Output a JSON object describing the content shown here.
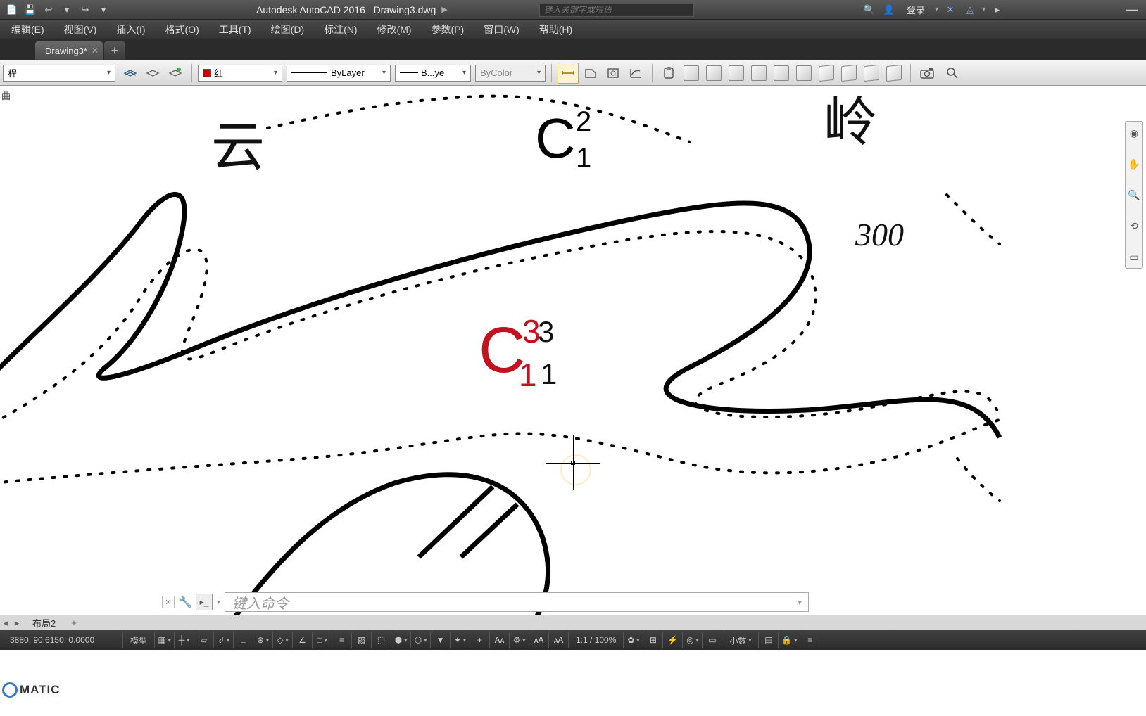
{
  "titlebar": {
    "app": "Autodesk AutoCAD 2016",
    "file": "Drawing3.dwg",
    "search_placeholder": "键入关键字或短语",
    "login": "登录"
  },
  "menu": {
    "items": [
      "编辑(E)",
      "视图(V)",
      "插入(I)",
      "格式(O)",
      "工具(T)",
      "绘图(D)",
      "标注(N)",
      "修改(M)",
      "参数(P)",
      "窗口(W)",
      "帮助(H)"
    ]
  },
  "doctabs": {
    "active": "Drawing3*"
  },
  "properties": {
    "layer": "程",
    "color": "红",
    "linetype": "ByLayer",
    "lineweight": "B...ye",
    "plotstyle": "ByColor"
  },
  "canvas": {
    "side_label": "曲",
    "text_yun": "云",
    "text_ling": "岭",
    "text_300": "300",
    "c12": {
      "C": "C",
      "sup": "2",
      "sub": "1"
    },
    "c13_red": {
      "C": "C",
      "sup": "3",
      "sub": "1"
    },
    "c13_blk": {
      "sup": "3",
      "sub": "1"
    }
  },
  "command": {
    "placeholder": "键入命令"
  },
  "layouts": {
    "tabs": [
      "模型",
      "布局2"
    ],
    "model_btn": "模型"
  },
  "status": {
    "coords": "3880, 90.6150, 0.0000",
    "scale": "1:1 / 100%",
    "units": "小数"
  },
  "watermark": "MATIC"
}
